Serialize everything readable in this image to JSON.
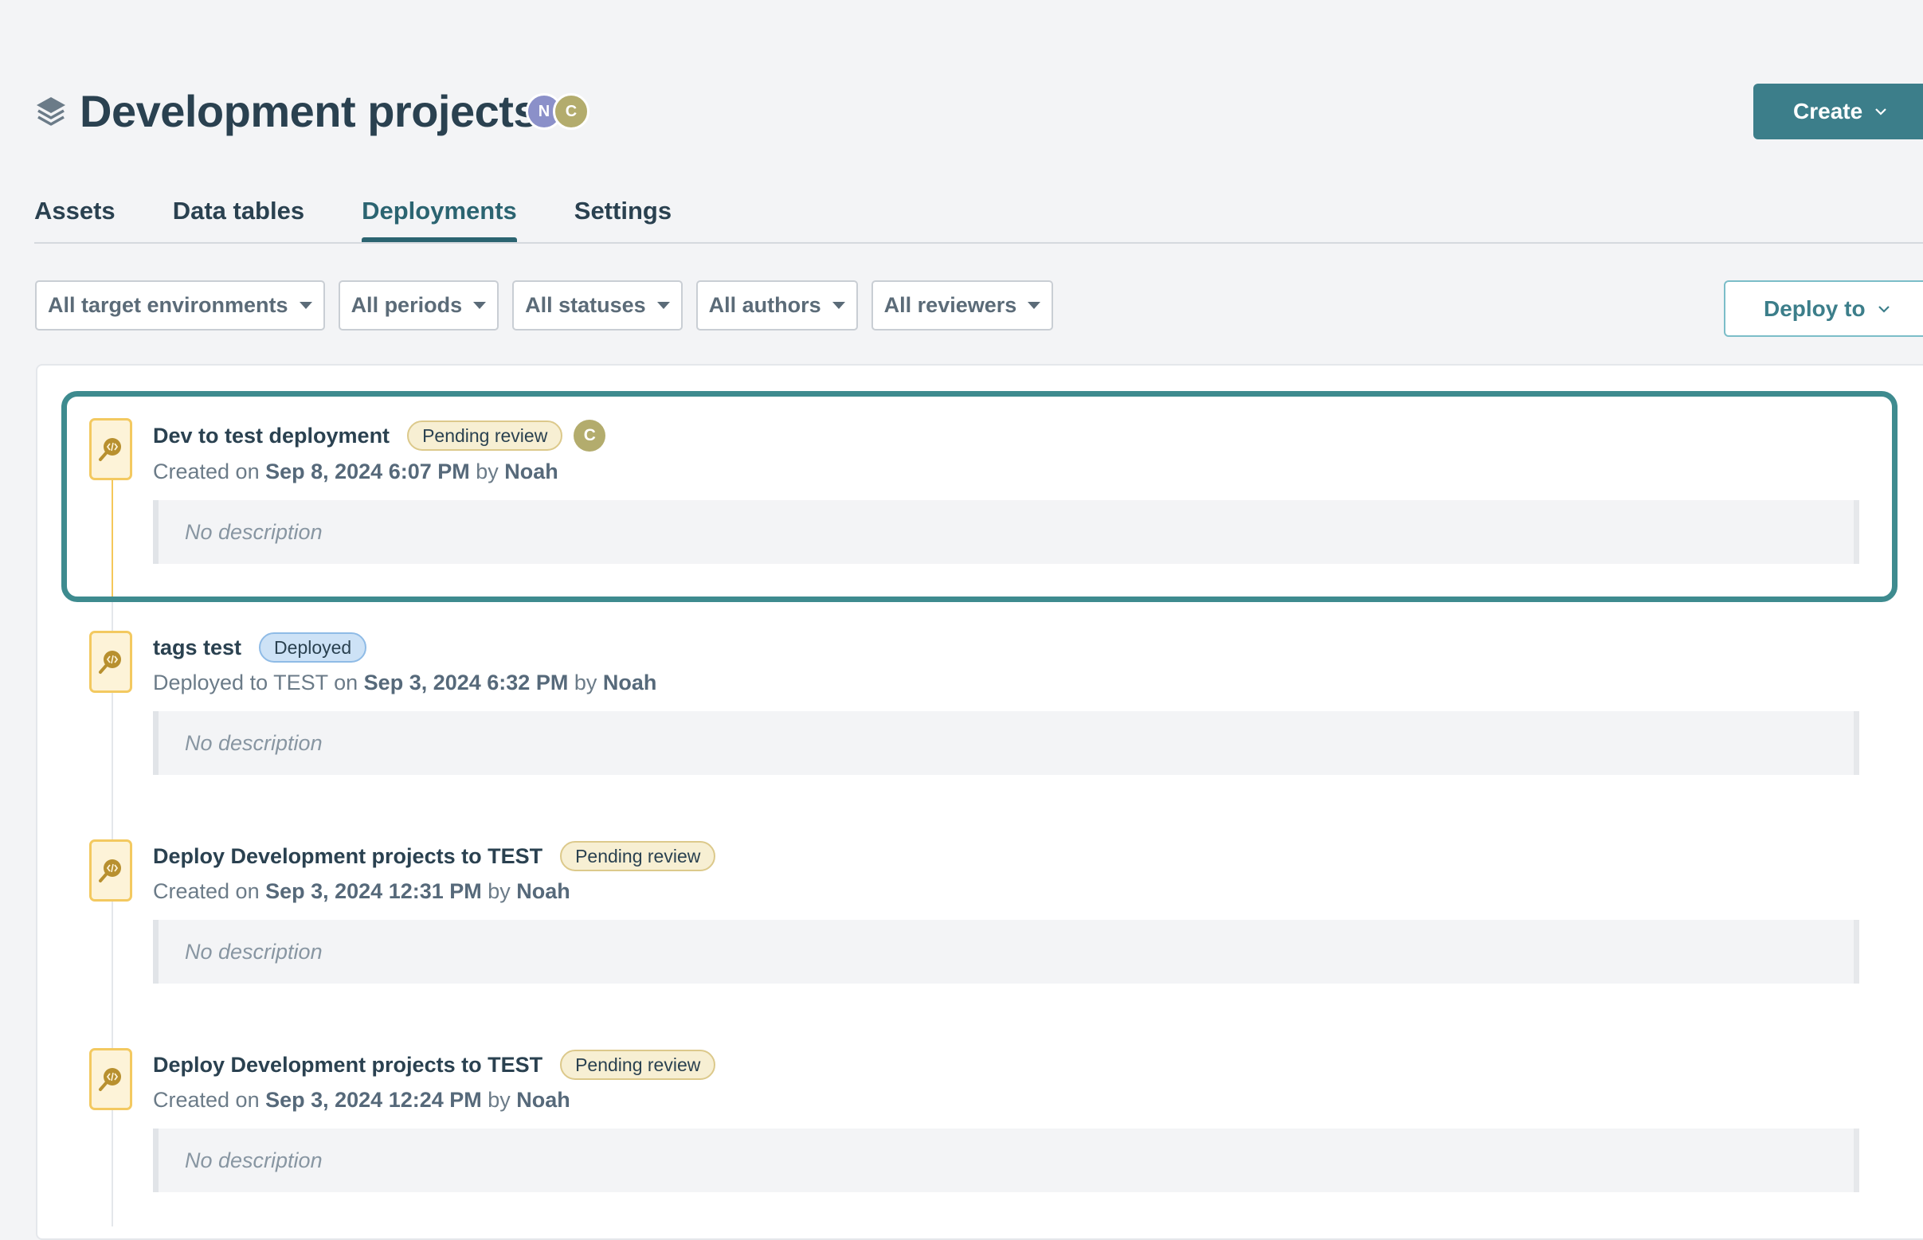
{
  "header": {
    "title": "Development projects",
    "page_icon": "layers-icon",
    "collaborators": [
      {
        "initial": "N",
        "color": "#8b90c9"
      },
      {
        "initial": "C",
        "color": "#b3ac6d"
      }
    ],
    "create_label": "Create"
  },
  "tabs": [
    {
      "label": "Assets",
      "active": false
    },
    {
      "label": "Data tables",
      "active": false
    },
    {
      "label": "Deployments",
      "active": true
    },
    {
      "label": "Settings",
      "active": false
    }
  ],
  "filters": [
    {
      "label": "All target environments"
    },
    {
      "label": "All periods"
    },
    {
      "label": "All statuses"
    },
    {
      "label": "All authors"
    },
    {
      "label": "All reviewers"
    }
  ],
  "deploy_to_label": "Deploy to",
  "deployments": [
    {
      "title": "Dev to test deployment",
      "status": "Pending review",
      "status_type": "pending",
      "reviewer_initial": "C",
      "meta_prefix": "Created on ",
      "date": "Sep 8, 2024 6:07 PM",
      "by": " by ",
      "author": "Noah",
      "description": "No description",
      "selected": true
    },
    {
      "title": "tags test",
      "status": "Deployed",
      "status_type": "deployed",
      "meta_prefix": "Deployed to TEST on ",
      "date": "Sep 3, 2024 6:32 PM",
      "by": " by ",
      "author": "Noah",
      "description": "No description",
      "selected": false
    },
    {
      "title": "Deploy Development projects to TEST",
      "status": "Pending review",
      "status_type": "pending",
      "meta_prefix": "Created on ",
      "date": "Sep 3, 2024 12:31 PM",
      "by": " by ",
      "author": "Noah",
      "description": "No description",
      "selected": false
    },
    {
      "title": "Deploy Development projects to TEST",
      "status": "Pending review",
      "status_type": "pending",
      "meta_prefix": "Created on ",
      "date": "Sep 3, 2024 12:24 PM",
      "by": " by ",
      "author": "Noah",
      "description": "No description",
      "selected": false
    }
  ],
  "colors": {
    "accent": "#3c7e8a",
    "highlight_border": "#3e8b8f",
    "pending_bg": "#f7efd3",
    "deployed_bg": "#cde2f6",
    "icon_bg": "#fdf3d8",
    "icon_border": "#f3c960"
  }
}
